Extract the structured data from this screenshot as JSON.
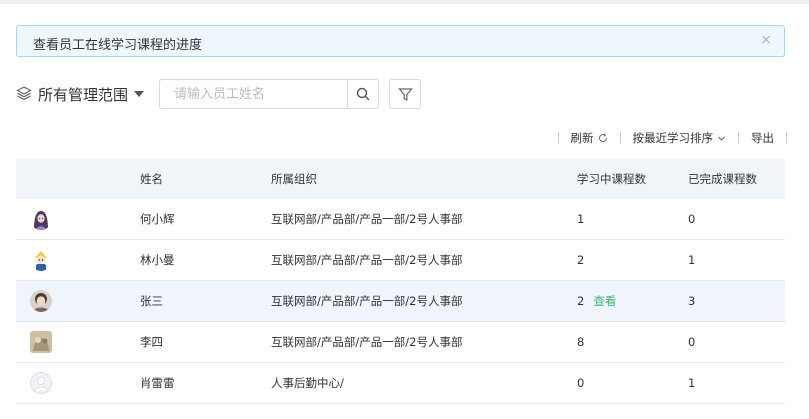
{
  "notice": {
    "text": "查看员工在线学习课程的进度",
    "close": "×"
  },
  "scope": {
    "label": "所有管理范围"
  },
  "search": {
    "placeholder": "请输入员工姓名",
    "value": ""
  },
  "toolbar": {
    "refresh": "刷新",
    "sort": "按最近学习排序",
    "export": "导出"
  },
  "table": {
    "headers": {
      "name": "姓名",
      "org": "所属组织",
      "in_progress": "学习中课程数",
      "completed": "已完成课程数"
    },
    "rows": [
      {
        "name": "何小辉",
        "org": "互联网部/产品部/产品一部/2号人事部",
        "in_progress": "1",
        "completed": "0",
        "avatar": "avatar-girl-purple"
      },
      {
        "name": "林小曼",
        "org": "互联网部/产品部/产品一部/2号人事部",
        "in_progress": "2",
        "completed": "1",
        "avatar": "avatar-cartoon"
      },
      {
        "name": "张三",
        "org": "互联网部/产品部/产品一部/2号人事部",
        "in_progress": "2",
        "completed": "3",
        "avatar": "avatar-photo",
        "action": "查看"
      },
      {
        "name": "李四",
        "org": "互联网部/产品部/产品一部/2号人事部",
        "in_progress": "8",
        "completed": "0",
        "avatar": "avatar-photo-beige"
      },
      {
        "name": "肖雷雷",
        "org": "人事后勤中心/",
        "in_progress": "0",
        "completed": "1",
        "avatar": "avatar-default"
      }
    ]
  },
  "colors": {
    "accent_link": "#3cb371",
    "notice_bg": "#eef7fc",
    "notice_border": "#a9d6f0",
    "header_bg": "#f0f5fa",
    "highlight_row": "#f0f5fb"
  }
}
